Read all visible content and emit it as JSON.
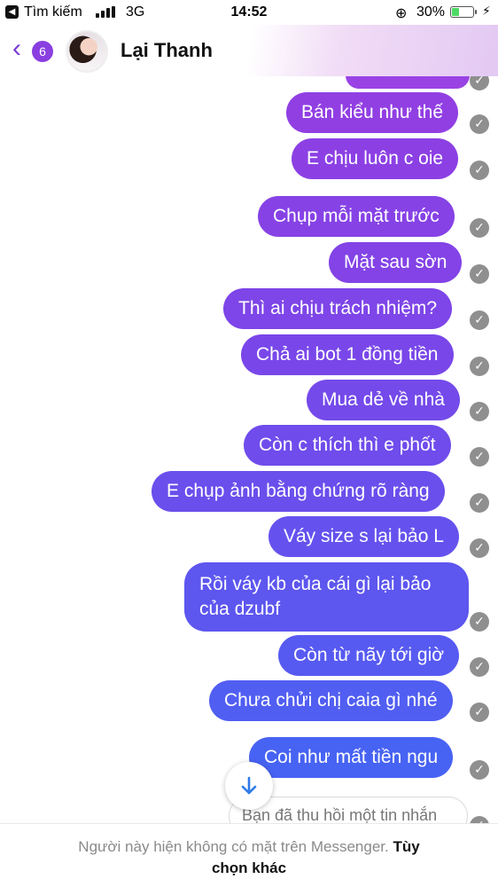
{
  "status_bar": {
    "back_app": "Tìm kiếm",
    "network": "3G",
    "time": "14:52",
    "battery": "30%",
    "battery_level": 0.3
  },
  "header": {
    "unread_count": "6",
    "contact_name": "Lại Thanh"
  },
  "messages": [
    "Bán kiểu như thế",
    "E chịu luôn c oie",
    "Chụp mỗi mặt trước",
    "Mặt sau sờn",
    "Thì ai chịu trách nhiệm?",
    "Chả ai bot 1 đồng tiền",
    "Mua dẻ về nhà",
    "Còn c thích thì e phốt",
    "E chụp ảnh bằng chứng rõ ràng",
    "Váy size s lại bảo L",
    "Rồi váy kb của cái gì lại bảo của dzubf",
    "Còn từ nãy tới giờ",
    "Chưa chửi chị caia gì nhé",
    "Coi như mất tiền ngu"
  ],
  "recalled_notice": "Bạn đã thu hồi một tin nhắn",
  "footer": {
    "notice": "Người này hiện không có mặt trên Messenger.",
    "option_line1": "Tùy",
    "option_line2": "chọn khác"
  },
  "colors": {
    "bubble_top": "#8f41e4",
    "bubble_bottom": "#3f6af2",
    "accent": "#8a3fe0"
  },
  "icons": [
    "back-chevron-icon",
    "signal-icon",
    "battery-icon",
    "lock-rotation-icon",
    "check-icon",
    "arrow-down-icon"
  ]
}
